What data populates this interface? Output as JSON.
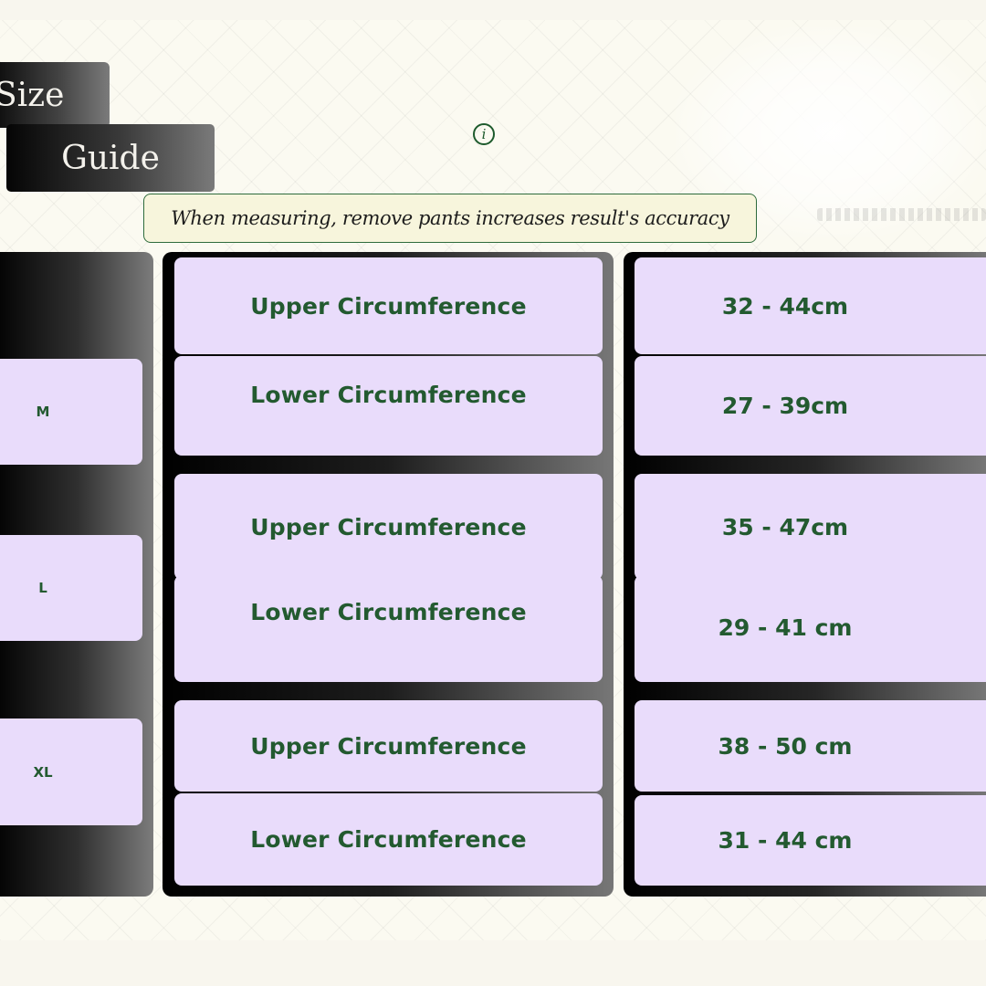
{
  "title": {
    "line1": "Size",
    "line2": "Guide"
  },
  "info_icon": {
    "glyph": "i"
  },
  "note": "When measuring, remove pants increases result's accuracy",
  "colors": {
    "text_green": "#235a30",
    "cell_lavender": "#e9dcfb",
    "note_border": "#2e6b3c"
  },
  "sizes": [
    {
      "label": "M",
      "upper_label": "Upper Circumference",
      "upper_value": "32 - 44cm",
      "lower_label": "Lower Circumference",
      "lower_value": "27 - 39cm"
    },
    {
      "label": "L",
      "upper_label": "Upper Circumference",
      "upper_value": "35 - 47cm",
      "lower_label": "Lower Circumference",
      "lower_value": "29 - 41 cm"
    },
    {
      "label": "XL",
      "upper_label": "Upper Circumference",
      "upper_value": "38 - 50 cm",
      "lower_label": "Lower Circumference",
      "lower_value": "31 - 44 cm"
    }
  ]
}
